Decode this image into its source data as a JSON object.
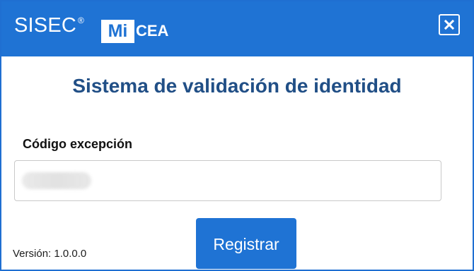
{
  "header": {
    "brand_text": "SISEC",
    "trademark": "®",
    "logo_mi": "Mi",
    "logo_cea": "CEA"
  },
  "main": {
    "title": "Sistema de validación de identidad",
    "exception_label": "Código excepción"
  },
  "actions": {
    "register_label": "Registrar"
  },
  "footer": {
    "version": "Versión: 1.0.0.0"
  },
  "icons": {
    "close": "close-icon"
  },
  "colors": {
    "primary": "#1f73d4",
    "title": "#214f86",
    "border": "#c9c9c9"
  }
}
